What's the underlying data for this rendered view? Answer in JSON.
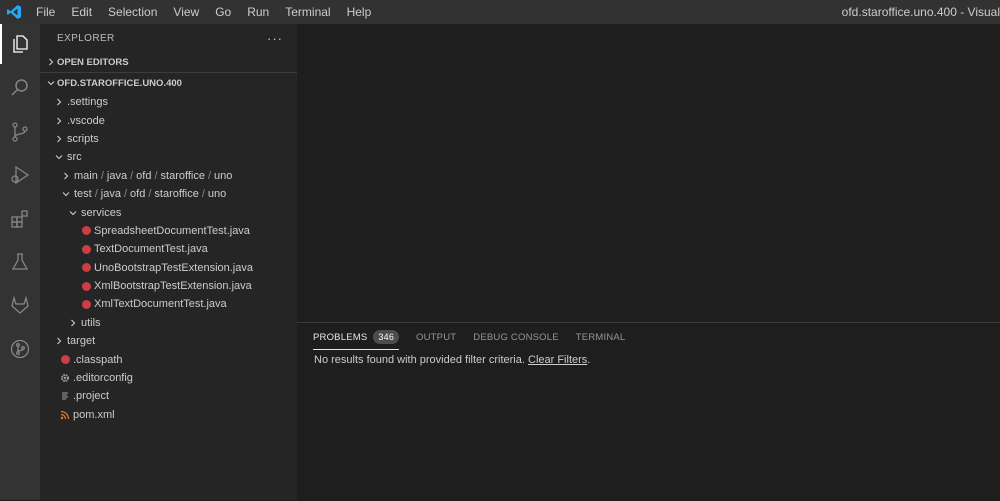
{
  "menu": [
    "File",
    "Edit",
    "Selection",
    "View",
    "Go",
    "Run",
    "Terminal",
    "Help"
  ],
  "window_title": "ofd.staroffice.uno.400 - Visual",
  "activity_bar": [
    "explorer",
    "search",
    "source-control",
    "run-and-debug",
    "extensions",
    "testing",
    "gitlab",
    "git-graph"
  ],
  "sidebar": {
    "title": "EXPLORER",
    "open_editors": "OPEN EDITORS",
    "project": "OFD.STAROFFICE.UNO.400",
    "tree": [
      {
        "label": "",
        "path": [
          ".settings"
        ],
        "indent": 0,
        "chevron": "right",
        "icon": ""
      },
      {
        "label": "",
        "path": [
          ".vscode"
        ],
        "indent": 0,
        "chevron": "right",
        "icon": ""
      },
      {
        "label": "",
        "path": [
          "scripts"
        ],
        "indent": 0,
        "chevron": "right",
        "icon": ""
      },
      {
        "label": "",
        "path": [
          "src"
        ],
        "indent": 0,
        "chevron": "down",
        "icon": ""
      },
      {
        "label": "",
        "path": [
          "main",
          "java",
          "ofd",
          "staroffice",
          "uno"
        ],
        "indent": 1,
        "chevron": "right",
        "icon": ""
      },
      {
        "label": "",
        "path": [
          "test",
          "java",
          "ofd",
          "staroffice",
          "uno"
        ],
        "indent": 1,
        "chevron": "down",
        "icon": ""
      },
      {
        "label": "",
        "path": [
          "services"
        ],
        "indent": 2,
        "chevron": "down",
        "icon": ""
      },
      {
        "label": "",
        "path": [
          "SpreadsheetDocumentTest.java"
        ],
        "indent": 3,
        "chevron": "",
        "icon": "java"
      },
      {
        "label": "",
        "path": [
          "TextDocumentTest.java"
        ],
        "indent": 3,
        "chevron": "",
        "icon": "java"
      },
      {
        "label": "",
        "path": [
          "UnoBootstrapTestExtension.java"
        ],
        "indent": 3,
        "chevron": "",
        "icon": "java"
      },
      {
        "label": "",
        "path": [
          "XmlBootstrapTestExtension.java"
        ],
        "indent": 3,
        "chevron": "",
        "icon": "java"
      },
      {
        "label": "",
        "path": [
          "XmlTextDocumentTest.java"
        ],
        "indent": 3,
        "chevron": "",
        "icon": "java"
      },
      {
        "label": "",
        "path": [
          "utils"
        ],
        "indent": 2,
        "chevron": "right",
        "icon": ""
      },
      {
        "label": "",
        "path": [
          "target"
        ],
        "indent": 0,
        "chevron": "right",
        "icon": ""
      },
      {
        "label": "",
        "path": [
          ".classpath"
        ],
        "indent": 0,
        "chevron": "",
        "icon": "java"
      },
      {
        "label": "",
        "path": [
          ".editorconfig"
        ],
        "indent": 0,
        "chevron": "",
        "icon": "gear"
      },
      {
        "label": "",
        "path": [
          ".project"
        ],
        "indent": 0,
        "chevron": "",
        "icon": "lines"
      },
      {
        "label": "",
        "path": [
          "pom.xml"
        ],
        "indent": 0,
        "chevron": "",
        "icon": "rss"
      }
    ]
  },
  "panel": {
    "tabs": [
      "PROBLEMS",
      "OUTPUT",
      "DEBUG CONSOLE",
      "TERMINAL"
    ],
    "problems_count": "346",
    "message": "No results found with provided filter criteria.",
    "clear_filters": "Clear Filters",
    "message_end": "."
  },
  "colors": {
    "accent": "#007acc",
    "java_icon": "#cc3e44",
    "xml_icon": "#e37933"
  }
}
